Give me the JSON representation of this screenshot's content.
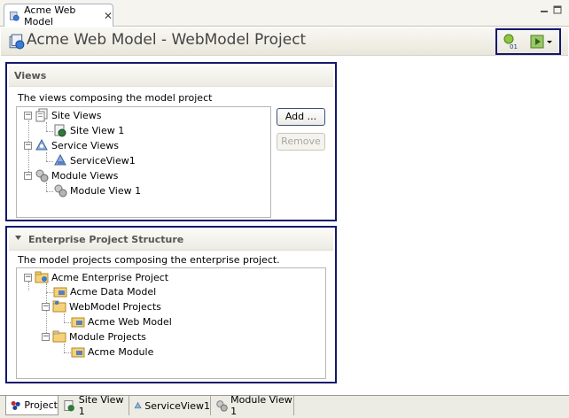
{
  "editor_tab": {
    "label": "Acme Web Model"
  },
  "header": {
    "title": "Acme Web Model - WebModel Project"
  },
  "views_section": {
    "title": "Views",
    "description": "The views composing the model project",
    "tree": {
      "site_views": "Site Views",
      "site_view_1": "Site View 1",
      "service_views": "Service Views",
      "service_view_1": "ServiceView1",
      "module_views": "Module Views",
      "module_view_1": "Module View 1"
    },
    "add_label": "Add ...",
    "remove_label": "Remove"
  },
  "enterprise_section": {
    "title": "Enterprise Project Structure",
    "description": "The model projects composing the enterprise project.",
    "tree": {
      "root": "Acme Enterprise Project",
      "data_model": "Acme Data Model",
      "webmodel_projects": "WebModel Projects",
      "web_model": "Acme Web Model",
      "module_projects": "Module Projects",
      "module": "Acme Module"
    }
  },
  "page_tabs": [
    "Project",
    "Site View 1",
    "ServiceView1",
    "Module View 1"
  ],
  "colors": {
    "highlight_border": "#14186d",
    "button_border": "#3c4f7a"
  }
}
